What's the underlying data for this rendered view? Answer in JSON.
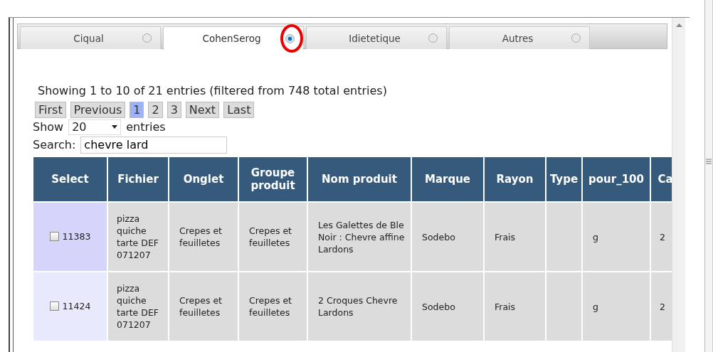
{
  "tabs": [
    {
      "label": "Ciqual",
      "selected": false,
      "circled": false
    },
    {
      "label": "CohenSerog",
      "selected": true,
      "circled": true
    },
    {
      "label": "Idietetique",
      "selected": false,
      "circled": false
    },
    {
      "label": "Autres",
      "selected": false,
      "circled": false
    }
  ],
  "info": "Showing 1 to 10 of 21 entries (filtered from 748 total entries)",
  "pagination": [
    {
      "label": "First",
      "selected": false
    },
    {
      "label": "Previous",
      "selected": false
    },
    {
      "label": "1",
      "selected": true
    },
    {
      "label": "2",
      "selected": false
    },
    {
      "label": "3",
      "selected": false
    },
    {
      "label": "Next",
      "selected": false
    },
    {
      "label": "Last",
      "selected": false
    }
  ],
  "length": {
    "before": "Show",
    "value": "20",
    "after": "entries"
  },
  "search": {
    "label": "Search:",
    "value": "chevre lard"
  },
  "table": {
    "columns": [
      "Select",
      "Fichier",
      "Onglet",
      "Groupe produit",
      "Nom produit",
      "Marque",
      "Rayon",
      "Type",
      "pour_100",
      "Ca"
    ],
    "rows": [
      {
        "id": "11383",
        "checked": false,
        "fichier": "pizza quiche tarte DEF 071207",
        "onglet": "Crepes et feuilletes",
        "groupe_produit": "Crepes et feuilletes",
        "nom_produit": "Les Galettes de Ble Noir : Chevre affine Lardons",
        "marque": "Sodebo",
        "rayon": "Frais",
        "pour_100": "g",
        "column_10": "2"
      },
      {
        "id": "11424",
        "checked": false,
        "fichier": "pizza quiche tarte DEF 071207",
        "onglet": "Crepes et feuilletes",
        "groupe_produit": "Crepes et feuilletes",
        "nom_produit": "2 Croques Chevre Lardons",
        "marque": "Sodebo",
        "rayon": "Frais",
        "pour_100": "g",
        "column_10": "2"
      }
    ]
  }
}
